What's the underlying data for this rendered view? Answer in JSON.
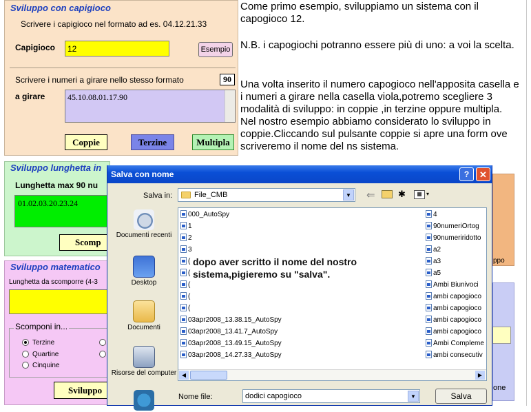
{
  "capigioco": {
    "title": "Sviluppo con capigioco",
    "hint": "Scrivere i capigioco nel formato ad es. 04.12.21.33",
    "label": "Capigioco",
    "value": "12",
    "example_button": "Esempio",
    "numbers_hint": "Scrivere i numeri a girare nello stesso formato",
    "count": "90",
    "numbers_label": "a girare",
    "numbers_value": "45.10.08.01.17.90",
    "btn_coppie": "Coppie",
    "btn_terzine": "Terzine",
    "btn_multipla": "Multipla"
  },
  "lunghetta": {
    "title": "Sviluppo lunghetta in",
    "label": "Lunghetta max 90 nu",
    "value": "01.02.03.20.23.24",
    "btn": "Scomp"
  },
  "matematico": {
    "title": "Sviluppo matematico",
    "label": "Lunghetta da scomporre (4-3",
    "group_title": "Scomponi in...",
    "radios": [
      "Terzine",
      "Quartine",
      "Cinquine"
    ],
    "selected": "Terzine",
    "btn": "Sviluppo"
  },
  "right_bits": {
    "ppo": "ppo",
    "one": "one"
  },
  "explanation": {
    "p1": "Come primo esempio, sviluppiamo un sistema con il capogioco 12.",
    "p2": "N.B. i capogiochi potranno essere più di uno: a voi la scelta.",
    "p3": "Una volta inserito il numero capogioco nell'apposita casella e i numeri a girare nella casella viola,potremo scegliere 3 modalità di sviluppo: in coppie ,in terzine oppure multipla.\nNel nostro esempio abbiamo considerato lo sviluppo in coppie.Cliccando sul pulsante coppie si apre una form ove scriveremo il nome del ns sistema."
  },
  "dialog": {
    "title": "Salva con nome",
    "save_in_label": "Salva in:",
    "folder": "File_CMB",
    "places": [
      "Documenti recenti",
      "Desktop",
      "Documenti",
      "Risorse del computer"
    ],
    "files_left": [
      "000_AutoSpy",
      "1",
      "2",
      "3",
      "(",
      "(",
      "(",
      "(",
      "(",
      "03apr2008_13.38.15_AutoSpy",
      "03apr2008_13.41.7_AutoSpy",
      "03apr2008_13.49.15_AutoSpy",
      "03apr2008_14.27.33_AutoSpy"
    ],
    "files_right": [
      "4",
      "90numeriOrtog",
      "90numeriridotto",
      "a2",
      "a3",
      "a5",
      "Ambi Biunivoci",
      "ambi capogioco",
      "ambi capogioco",
      "ambi capogioco",
      "ambi capogioco",
      "Ambi Compleme",
      "ambi consecutiv"
    ],
    "annotation": "dopo aver scritto il nome del nostro sistema,pigieremo su \"salva\".",
    "filename_label": "Nome file:",
    "filename_value": "dodici capogioco",
    "save_button": "Salva"
  }
}
